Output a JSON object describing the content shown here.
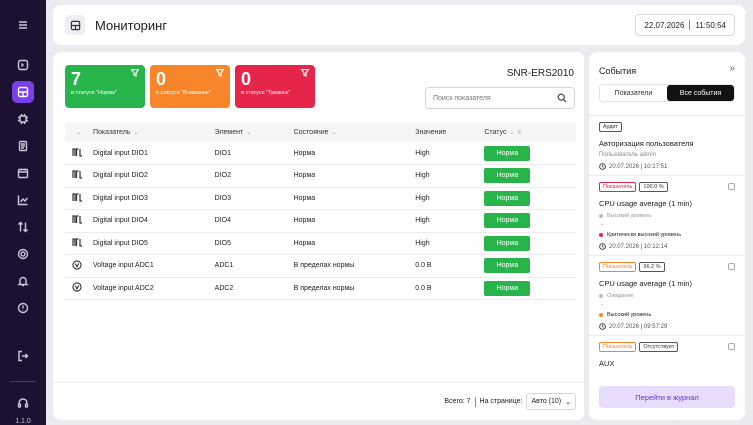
{
  "sidebar": {
    "version": "1.1.0"
  },
  "header": {
    "title": "Мониторинг",
    "date": "22.07.2026",
    "time": "11:50:54"
  },
  "summary": {
    "device": "SNR-ERS2010",
    "cards": [
      {
        "count": "7",
        "label": "в статусе \"Норма\"",
        "color": "#27b44a"
      },
      {
        "count": "0",
        "label": "в статусе \"Внимание\"",
        "color": "#f7862b"
      },
      {
        "count": "0",
        "label": "в статусе \"Тревога\"",
        "color": "#e5254a"
      }
    ]
  },
  "search": {
    "placeholder": "Поиск показателя",
    "value": ""
  },
  "table": {
    "headers": {
      "indicator": "Показатель",
      "element": "Элемент",
      "state": "Состояние",
      "value": "Значение",
      "status": "Статус"
    },
    "rows": [
      {
        "icon": "digital-input-icon",
        "indicator": "Digital input DIO1",
        "element": "DIO1",
        "state": "Норма",
        "value": "High",
        "status": "Норма"
      },
      {
        "icon": "digital-input-icon",
        "indicator": "Digital input DIO2",
        "element": "DIO2",
        "state": "Норма",
        "value": "High",
        "status": "Норма"
      },
      {
        "icon": "digital-input-icon",
        "indicator": "Digital input DIO3",
        "element": "DIO3",
        "state": "Норма",
        "value": "High",
        "status": "Норма"
      },
      {
        "icon": "digital-input-icon",
        "indicator": "Digital input DIO4",
        "element": "DIO4",
        "state": "Норма",
        "value": "High",
        "status": "Норма"
      },
      {
        "icon": "digital-input-icon",
        "indicator": "Digital input DIO5",
        "element": "DIO5",
        "state": "Норма",
        "value": "High",
        "status": "Норма"
      },
      {
        "icon": "voltage-icon",
        "indicator": "Voltage input ADC1",
        "element": "ADC1",
        "state": "В пределах нормы",
        "value": "0.0 В",
        "status": "Норма"
      },
      {
        "icon": "voltage-icon",
        "indicator": "Voltage input ADC2",
        "element": "ADC2",
        "state": "В пределах нормы",
        "value": "0.0 В",
        "status": "Норма"
      }
    ]
  },
  "footer": {
    "total": "Всего: 7",
    "per_page_label": "На странице:",
    "per_page_value": "Авто (10)"
  },
  "events": {
    "title": "События",
    "tabs": [
      "Показатели",
      "Все события"
    ],
    "active_tab": 1,
    "items": [
      {
        "tags": [
          "Аудит"
        ],
        "name": "Авторизация пользователя",
        "user": "Пользователь admin",
        "time": "20.07.2026 | 10:17:51"
      },
      {
        "tags": [
          "Показатель",
          "100.0 %"
        ],
        "name": "CPU usage average (1 min)",
        "from": "Высокий уровень",
        "to": "Критически высокий уровень",
        "time": "20.07.2026 | 10:12:14"
      },
      {
        "tags": [
          "Показатель",
          "96.2 %"
        ],
        "name": "CPU usage average (1 min)",
        "from": "Ожидание",
        "to": "Высокий уровень",
        "time": "20.07.2026 | 09:57:29"
      },
      {
        "tags": [
          "Показатель",
          "Отсутствует"
        ],
        "name": "AUX"
      }
    ],
    "journal_button": "Перейти в журнал"
  }
}
